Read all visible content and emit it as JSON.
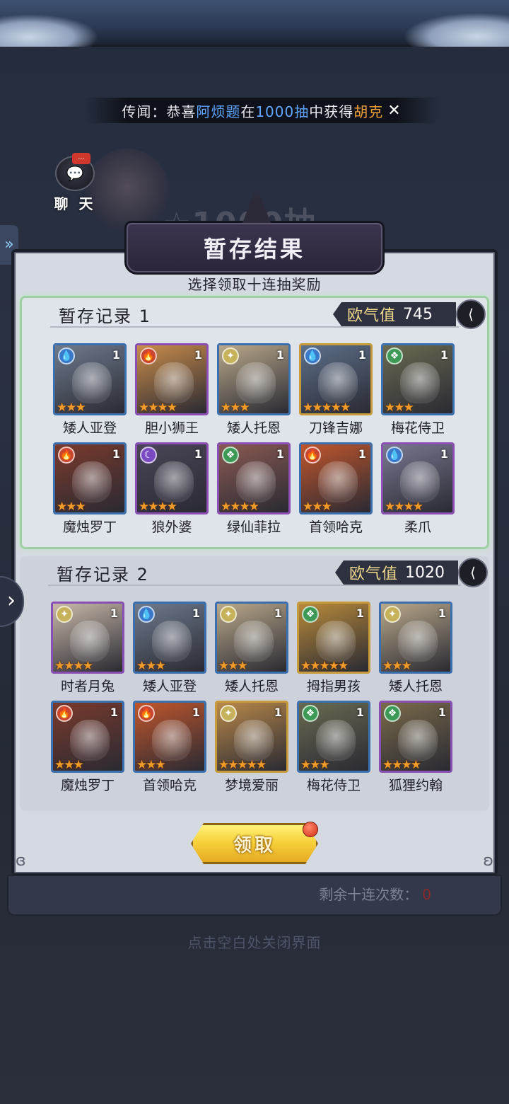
{
  "rumor": {
    "prefix": "传闻：恭喜",
    "player": "阿烦题",
    "mid1": "在",
    "draws": "1000抽",
    "mid2": "中获得",
    "item": "胡克",
    "close_icon": "crossed-swords-icon"
  },
  "chat": {
    "label": "聊 天",
    "badge": "...",
    "icon": "chat-bubble-icon"
  },
  "background_banner": "☆1000抽",
  "panel": {
    "title": "暂存结果",
    "subtitle": "选择领取十连抽奖励"
  },
  "records": [
    {
      "title": "暂存记录 1",
      "luck_label": "欧气值",
      "luck_value": "745",
      "selected": true,
      "heroes": [
        {
          "name": "矮人亚登",
          "element": "water",
          "count": "1",
          "stars": 3,
          "frame": "blue",
          "color": "#6e7a8c"
        },
        {
          "name": "胆小狮王",
          "element": "fire",
          "count": "1",
          "stars": 4,
          "frame": "purple",
          "color": "#c98c4a"
        },
        {
          "name": "矮人托恩",
          "element": "light",
          "count": "1",
          "stars": 3,
          "frame": "blue",
          "color": "#b9a88a"
        },
        {
          "name": "刀锋吉娜",
          "element": "water",
          "count": "1",
          "stars": 5,
          "frame": "gold",
          "color": "#5d6f8a"
        },
        {
          "name": "梅花侍卫",
          "element": "nature",
          "count": "1",
          "stars": 3,
          "frame": "blue",
          "color": "#6a6a52"
        },
        {
          "name": "魔烛罗丁",
          "element": "fire",
          "count": "1",
          "stars": 3,
          "frame": "blue",
          "color": "#7a3a2c"
        },
        {
          "name": "狼外婆",
          "element": "dark",
          "count": "1",
          "stars": 4,
          "frame": "purple",
          "color": "#4a4658"
        },
        {
          "name": "绿仙菲拉",
          "element": "nature",
          "count": "1",
          "stars": 4,
          "frame": "purple",
          "color": "#8a5a52"
        },
        {
          "name": "首领哈克",
          "element": "fire",
          "count": "1",
          "stars": 3,
          "frame": "blue",
          "color": "#c0562c"
        },
        {
          "name": "柔爪",
          "element": "water",
          "count": "1",
          "stars": 4,
          "frame": "purple",
          "color": "#7a7890"
        }
      ]
    },
    {
      "title": "暂存记录 2",
      "luck_label": "欧气值",
      "luck_value": "1020",
      "selected": false,
      "heroes": [
        {
          "name": "时者月兔",
          "element": "light",
          "count": "1",
          "stars": 4,
          "frame": "purple",
          "color": "#c8b8a8"
        },
        {
          "name": "矮人亚登",
          "element": "water",
          "count": "1",
          "stars": 3,
          "frame": "blue",
          "color": "#6e7a8c"
        },
        {
          "name": "矮人托恩",
          "element": "light",
          "count": "1",
          "stars": 3,
          "frame": "blue",
          "color": "#b9a88a"
        },
        {
          "name": "拇指男孩",
          "element": "nature",
          "count": "1",
          "stars": 5,
          "frame": "gold",
          "color": "#b88a3a"
        },
        {
          "name": "矮人托恩",
          "element": "light",
          "count": "1",
          "stars": 3,
          "frame": "blue",
          "color": "#b9a88a"
        },
        {
          "name": "魔烛罗丁",
          "element": "fire",
          "count": "1",
          "stars": 3,
          "frame": "blue",
          "color": "#7a3a2c"
        },
        {
          "name": "首领哈克",
          "element": "fire",
          "count": "1",
          "stars": 3,
          "frame": "blue",
          "color": "#c0562c"
        },
        {
          "name": "梦境爱丽",
          "element": "light",
          "count": "1",
          "stars": 5,
          "frame": "gold",
          "color": "#b8884a"
        },
        {
          "name": "梅花侍卫",
          "element": "nature",
          "count": "1",
          "stars": 3,
          "frame": "blue",
          "color": "#6a6a52"
        },
        {
          "name": "狐狸约翰",
          "element": "nature",
          "count": "1",
          "stars": 4,
          "frame": "purple",
          "color": "#7a6a4a"
        }
      ]
    }
  ],
  "claim_button": "领取",
  "remaining": {
    "label": "剩余十连次数：",
    "value": "0"
  },
  "close_hint": "点击空白处关闭界面",
  "element_icons": {
    "water": {
      "glyph": "💧",
      "icon": "water-element-icon"
    },
    "fire": {
      "glyph": "🔥",
      "icon": "fire-element-icon"
    },
    "light": {
      "glyph": "✦",
      "icon": "light-element-icon"
    },
    "nature": {
      "glyph": "❖",
      "icon": "nature-element-icon"
    },
    "dark": {
      "glyph": "☾",
      "icon": "dark-element-icon"
    }
  },
  "colors": {
    "accent_gold": "#f6d23a",
    "luck_text": "#f0d98a",
    "selected_border": "#9fd0a4"
  }
}
